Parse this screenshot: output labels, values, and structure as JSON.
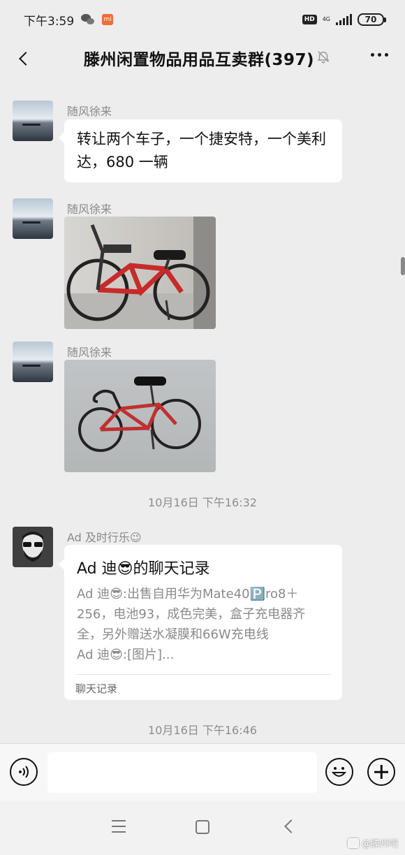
{
  "status_bar": {
    "time": "下午3:59",
    "network": "4G",
    "hd": "HD",
    "battery": "70"
  },
  "header": {
    "title": "滕州闲置物品用品互卖群(397)"
  },
  "messages": [
    {
      "sender": "随风徐来",
      "type": "text",
      "text": "转让两个车子，一个捷安特，一个美利达，680 一辆"
    },
    {
      "sender": "随风徐来",
      "type": "image"
    },
    {
      "sender": "随风徐来",
      "type": "image"
    }
  ],
  "timestamps": [
    "10月16日 下午16:32",
    "10月16日 下午16:46"
  ],
  "chat_record": {
    "sender": "Ad 及时行乐😉",
    "title": "Ad 迪😎的聊天记录",
    "lines": [
      "Ad 迪😎:出售自用华为Mate40🅿️ro8＋256，电池93，成色完美，盒子充电器齐全，另外赠送水凝膜和66W充电线",
      "Ad 迪😎:[图片]..."
    ],
    "footer": "聊天记录"
  },
  "input": {
    "placeholder": ""
  },
  "watermark": "@滕州吧"
}
